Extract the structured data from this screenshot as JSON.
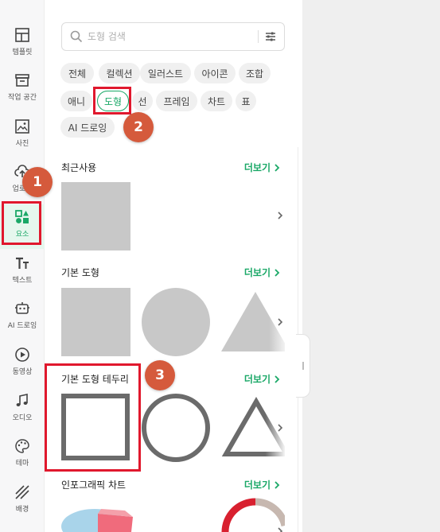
{
  "rail": {
    "items": [
      {
        "label": "템플릿",
        "icon": "template-icon"
      },
      {
        "label": "작업 공간",
        "icon": "workspace-icon"
      },
      {
        "label": "사진",
        "icon": "photo-icon"
      },
      {
        "label": "업로드",
        "icon": "upload-icon"
      },
      {
        "label": "요소",
        "icon": "elements-icon",
        "active": true
      },
      {
        "label": "텍스트",
        "icon": "text-icon"
      },
      {
        "label": "AI 드로잉",
        "icon": "ai-drawing-icon"
      },
      {
        "label": "동영상",
        "icon": "video-icon"
      },
      {
        "label": "오디오",
        "icon": "audio-icon"
      },
      {
        "label": "테마",
        "icon": "theme-icon"
      },
      {
        "label": "배경",
        "icon": "background-icon"
      }
    ]
  },
  "search": {
    "placeholder": "도형 검색",
    "icon": "search-icon",
    "filter_icon": "filter-icon"
  },
  "chips": [
    "전체",
    "컬렉션",
    "일러스트",
    "아이콘",
    "조합",
    "애니",
    "도형",
    "선",
    "프레임",
    "차트",
    "표",
    "AI 드로잉"
  ],
  "selected_chip": "도형",
  "sections": {
    "recent": {
      "title": "최근사용",
      "more": "더보기"
    },
    "basic": {
      "title": "기본 도형",
      "more": "더보기"
    },
    "outline": {
      "title": "기본 도형 테두리",
      "more": "더보기"
    },
    "infographic": {
      "title": "인포그래픽 차트",
      "more": "더보기"
    }
  },
  "annotations": {
    "badge1": "1",
    "badge2": "2",
    "badge3": "3"
  },
  "colors": {
    "accent": "#1aa867",
    "highlight": "#e0182d",
    "badge": "#d55a3c",
    "shape_fill": "#c8c8c8",
    "shape_outline": "#6b6b6b"
  }
}
